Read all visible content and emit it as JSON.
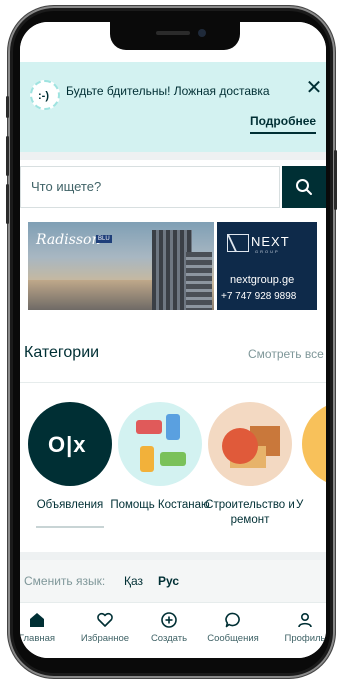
{
  "alert": {
    "text": "Будьте бдительны! Ложная доставка",
    "more_label": "Подробнее",
    "close_label": "✕"
  },
  "search": {
    "placeholder": "Что ищете?"
  },
  "banner": {
    "brand_left": "Radisson",
    "brand_left_tag": "BLU",
    "brand_right": "NEXT",
    "brand_right_sub": "GROUP",
    "url": "nextgroup.ge",
    "phone": "+7 747 928 9898"
  },
  "categories": {
    "title": "Категории",
    "see_all": "Смотреть все",
    "items": [
      {
        "label": "Объявления"
      },
      {
        "label": "Помощь Костанаю"
      },
      {
        "label": "Строительство и ремонт"
      },
      {
        "label": "У"
      }
    ]
  },
  "language": {
    "label": "Сменить язык:",
    "kz": "Қаз",
    "ru": "Рус"
  },
  "tabbar": {
    "items": [
      {
        "label": "Главная",
        "icon": "home-icon"
      },
      {
        "label": "Избранное",
        "icon": "heart-icon"
      },
      {
        "label": "Создать",
        "icon": "plus-circle-icon"
      },
      {
        "label": "Сообщения",
        "icon": "chat-icon"
      },
      {
        "label": "Профиль",
        "icon": "user-icon"
      }
    ]
  },
  "colors": {
    "brand_dark": "#002f34",
    "alert_bg": "#d3f2f1",
    "muted_text": "#7f9799"
  }
}
